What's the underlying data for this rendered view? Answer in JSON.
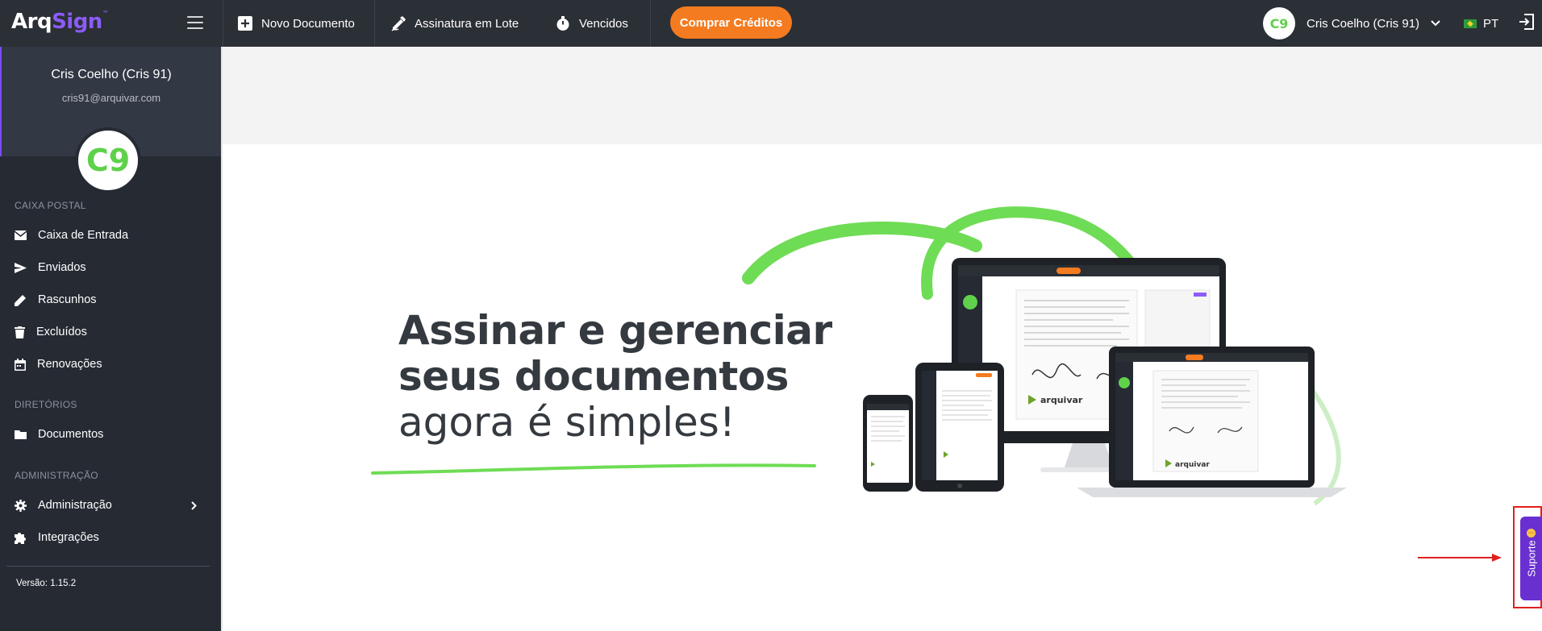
{
  "topbar": {
    "logo_prefix": "Arq",
    "logo_suffix": "Sign",
    "logo_tm": "™",
    "nav": [
      {
        "label": "Novo Documento",
        "icon": "plus-square-icon"
      },
      {
        "label": "Assinatura em Lote",
        "icon": "pen-sign-icon"
      },
      {
        "label": "Vencidos",
        "icon": "stopwatch-icon"
      }
    ],
    "buy_label": "Comprar Créditos",
    "avatar_initials": "C9",
    "user_name": "Cris Coelho (Cris 91)",
    "language": "PT"
  },
  "sidebar": {
    "profile_name": "Cris Coelho (Cris 91)",
    "profile_email": "cris91@arquivar.com",
    "avatar_initials": "C9",
    "sections": [
      {
        "title": "CAIXA POSTAL",
        "items": [
          {
            "label": "Caixa de Entrada",
            "icon": "envelope-icon"
          },
          {
            "label": "Enviados",
            "icon": "send-icon"
          },
          {
            "label": "Rascunhos",
            "icon": "pencil-icon"
          },
          {
            "label": "Excluídos",
            "icon": "trash-icon"
          },
          {
            "label": "Renovações",
            "icon": "calendar-icon"
          }
        ]
      },
      {
        "title": "DIRETÓRIOS",
        "items": [
          {
            "label": "Documentos",
            "icon": "folder-icon"
          }
        ]
      },
      {
        "title": "ADMINISTRAÇÃO",
        "items": [
          {
            "label": "Administração",
            "icon": "gear-icon"
          },
          {
            "label": "Integrações",
            "icon": "puzzle-icon"
          }
        ]
      }
    ],
    "version": "Versão: 1.15.2"
  },
  "hero": {
    "line1": "Assinar e gerenciar",
    "line2": "seus documentos",
    "line3": "agora é simples!",
    "brand_on_devices": "arquivar"
  },
  "support": {
    "label": "Suporte"
  },
  "colors": {
    "topbar": "#2b2f36",
    "sidebar": "#252a33",
    "accent_orange": "#f47b20",
    "accent_green": "#5fd14b",
    "accent_purple": "#6a2fd1",
    "annotation_red": "#e02020"
  }
}
